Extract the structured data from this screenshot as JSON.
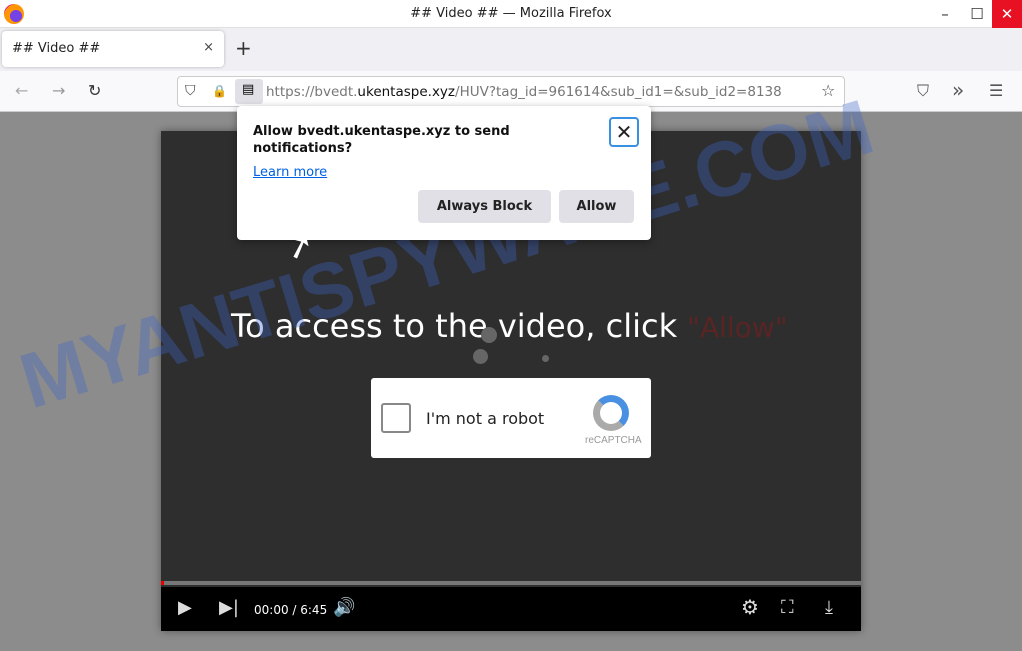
{
  "window": {
    "title": "## Video ## — Mozilla Firefox",
    "minimize": "–",
    "maximize": "☐",
    "close": "✕"
  },
  "tabs": [
    {
      "label": "## Video ##",
      "close": "×"
    }
  ],
  "new_tab": "+",
  "nav": {
    "back": "←",
    "forward": "→",
    "reload": "↻",
    "url_prefix": "https://bvedt.",
    "url_domain": "ukentaspe.xyz",
    "url_rest": "/HUV?tag_id=961614&sub_id1=&sub_id2=8138",
    "shield": "⛉",
    "lock": "🔒",
    "bookmark": "☆",
    "pocket": "⛉",
    "overflow": "»",
    "menu": "☰"
  },
  "popup": {
    "message": "Allow bvedt.ukentaspe.xyz to send notifications?",
    "learn_more": "Learn more",
    "block": "Always Block",
    "allow": "Allow",
    "close": "✕"
  },
  "page": {
    "headline": "To access to the video, click",
    "headline_highlight": "\"Allow\"",
    "captcha_label": "I'm not a robot",
    "captcha_brand": "reCAPTCHA"
  },
  "player": {
    "time": "00:00 / 6:45",
    "progress": 0.004
  },
  "watermark": "MYANTISPYWARE.COM"
}
